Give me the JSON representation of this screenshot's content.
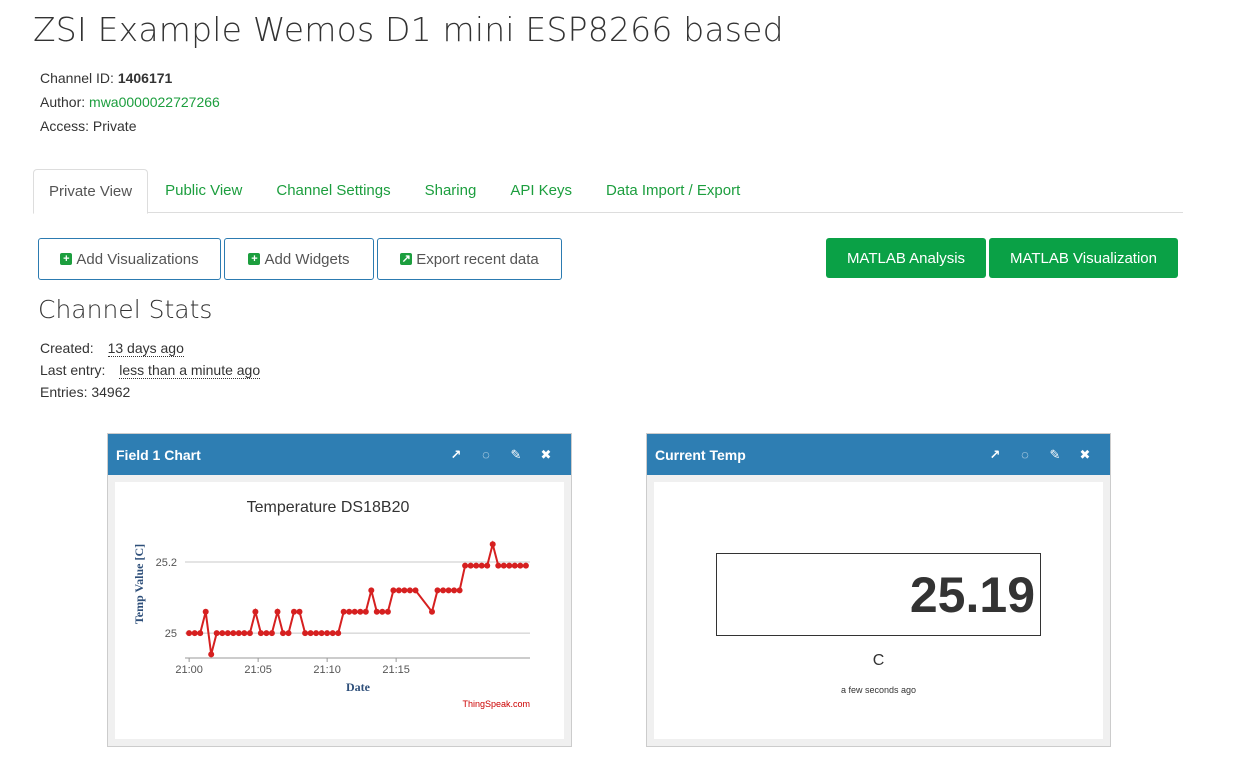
{
  "page": {
    "title": "ZSI Example Wemos D1 mini ESP8266 based"
  },
  "channel": {
    "id_label": "Channel ID:",
    "id": "1406171",
    "author_label": "Author:",
    "author": "mwa0000022727266",
    "access_label": "Access:",
    "access": "Private"
  },
  "tabs": [
    {
      "label": "Private View",
      "active": true
    },
    {
      "label": "Public View"
    },
    {
      "label": "Channel Settings"
    },
    {
      "label": "Sharing"
    },
    {
      "label": "API Keys"
    },
    {
      "label": "Data Import / Export"
    }
  ],
  "toolbar": {
    "add_visualizations": "Add Visualizations",
    "add_widgets": "Add Widgets",
    "export_recent": "Export recent data",
    "matlab_analysis": "MATLAB Analysis",
    "matlab_visualization": "MATLAB Visualization"
  },
  "stats": {
    "title": "Channel Stats",
    "created_label": "Created:",
    "created": "13 days ago",
    "last_entry_label": "Last entry:",
    "last_entry": "less than a minute ago",
    "entries_label": "Entries:",
    "entries": "34962"
  },
  "widgets": {
    "field1": {
      "title": "Field 1 Chart"
    },
    "current": {
      "title": "Current Temp",
      "value": "25.19",
      "unit": "C",
      "updated": "a few seconds ago"
    }
  },
  "colors": {
    "accent_green": "#1c9e3e",
    "header_blue": "#2e7eb3",
    "series_red": "#d62020"
  },
  "chart_data": {
    "type": "line",
    "title": "Temperature DS18B20",
    "xlabel": "Date",
    "ylabel": "Temp Value [C]",
    "credit": "ThingSpeak.com",
    "x_ticks": [
      "21:00",
      "21:05",
      "21:10",
      "21:15"
    ],
    "y_ticks": [
      "25",
      "25.2"
    ],
    "ylim": [
      24.93,
      25.29
    ],
    "grid": true,
    "series": [
      {
        "values": [
          25.0,
          25.0,
          25.0,
          25.06,
          24.94,
          25.0,
          25.0,
          25.0,
          25.0,
          25.0,
          25.0,
          25.0,
          25.06,
          25.0,
          25.0,
          25.0,
          25.06,
          25.0,
          25.0,
          25.06,
          25.06,
          25.0,
          25.0,
          25.0,
          25.0,
          25.0,
          25.0,
          25.0,
          25.06,
          25.06,
          25.06,
          25.06,
          25.06,
          25.12,
          25.06,
          25.06,
          25.06,
          25.12,
          25.12,
          25.12,
          25.12,
          25.12,
          25.06,
          25.12,
          25.12,
          25.12,
          25.12,
          25.12,
          25.19,
          25.19,
          25.19,
          25.19,
          25.19,
          25.25,
          25.19,
          25.19,
          25.19,
          25.19,
          25.19,
          25.19
        ],
        "minutes": [
          0,
          0.4,
          0.8,
          1.2,
          1.6,
          2.0,
          2.4,
          2.8,
          3.2,
          3.6,
          4.0,
          4.4,
          4.8,
          5.2,
          5.6,
          6.0,
          6.4,
          6.8,
          7.2,
          7.6,
          8.0,
          8.4,
          8.8,
          9.2,
          9.6,
          10.0,
          10.4,
          10.8,
          11.2,
          11.6,
          12.0,
          12.4,
          12.8,
          13.2,
          13.6,
          14.0,
          14.4,
          14.8,
          15.2,
          15.6,
          16.0,
          16.4,
          17.6,
          18.0,
          18.4,
          18.8,
          19.2,
          19.6,
          20.0,
          20.4,
          20.8,
          21.2,
          21.6,
          22.0,
          22.4,
          22.8,
          23.2,
          23.6,
          24.0,
          24.4
        ]
      }
    ]
  }
}
